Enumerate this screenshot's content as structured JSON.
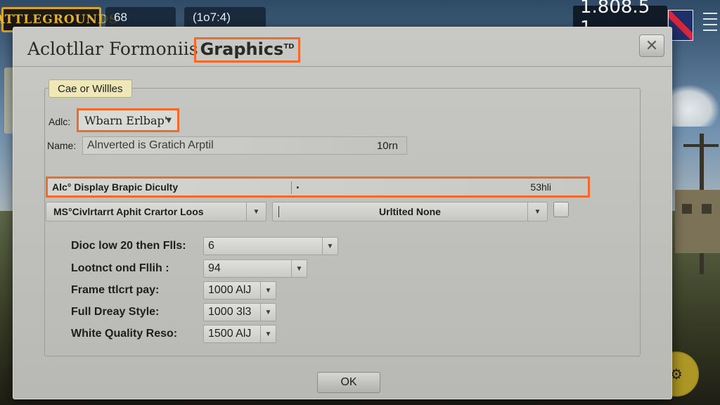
{
  "hud": {
    "logo_text": "BATTLEGROUNDS",
    "pill_left": "68",
    "pill_center": "(1o7:4)",
    "counter": "1.808.5 1",
    "round_icon": "gear-badge-icon",
    "flag_icon": "uk-flag-icon",
    "grip_icon": "menu-grip-icon"
  },
  "dialog": {
    "title_prefix": "Aclotllar Formoniis",
    "title_highlight": "Graphics",
    "title_mark": "TD",
    "close_icon": "close-icon",
    "close_glyph": "✕",
    "group_label": "Cae or Willles",
    "adlc_label": "Adlc:",
    "adlc_value": "Wbarn Erlbap'",
    "name_label": "Name:",
    "name_value": "Alnverted is Gratich Arptil",
    "name_value_right": "10rn",
    "display_quality_label": "Alc° Display Brapic Diculty",
    "display_quality_value": "53hli",
    "mode_combo_value": "MS°Civlrtarrt Aphit Crartor Loos",
    "limit_combo_value": "Urltited None",
    "spin_rows": [
      {
        "label": "Dioc low 20 then Flls:",
        "value": "6"
      },
      {
        "label": "Lootnct ond Fllih :",
        "value": "94"
      },
      {
        "label": "Frame ttlcrt pay:",
        "value": "1000 AlJ"
      },
      {
        "label": "Full Dreay Style:",
        "value": "1000 3l3"
      },
      {
        "label": "White Quality Reso:",
        "value": "1500 AlJ"
      }
    ],
    "ok_label": "OK"
  },
  "colors": {
    "highlight": "#ef6a2c",
    "dialog_bg": "#c0c0bd",
    "logo_gold": "#d6a52a"
  }
}
